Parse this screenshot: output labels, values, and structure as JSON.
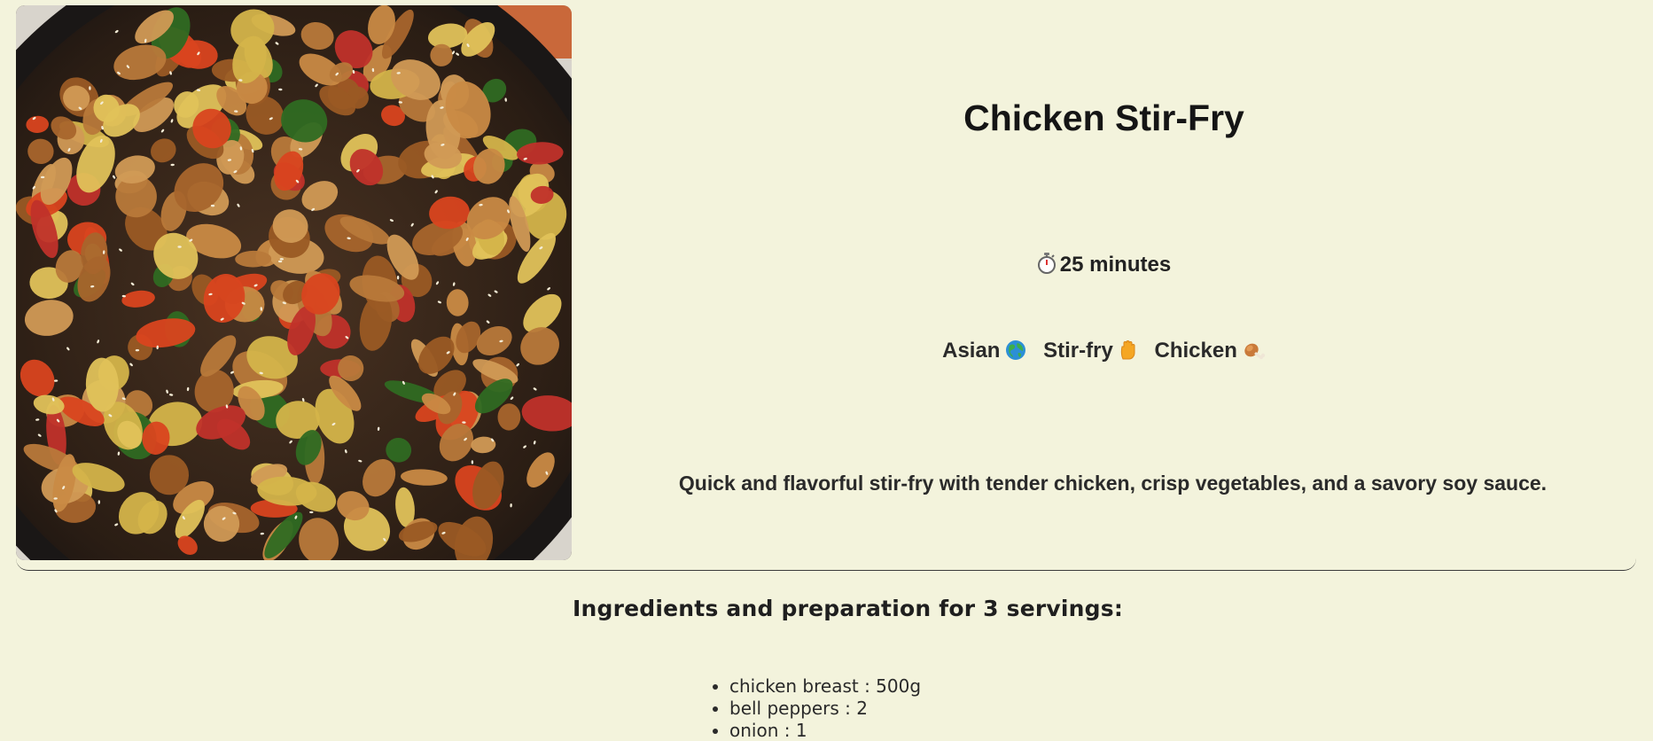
{
  "recipe": {
    "title": "Chicken Stir-Fry",
    "time": "25 minutes",
    "tags": [
      {
        "label": "Asian",
        "icon": "globe-icon"
      },
      {
        "label": "Stir-fry",
        "icon": "hand-icon"
      },
      {
        "label": "Chicken",
        "icon": "drumstick-icon"
      }
    ],
    "description": "Quick and flavorful stir-fry with tender chicken, crisp vegetables, and a savory soy sauce."
  },
  "ingredients": {
    "heading": "Ingredients and preparation for 3 servings:",
    "items": [
      "chicken breast : 500g",
      "bell peppers : 2",
      "onion : 1"
    ]
  },
  "colors": {
    "background": "#f3f3dc",
    "text": "#1c1c1c"
  }
}
